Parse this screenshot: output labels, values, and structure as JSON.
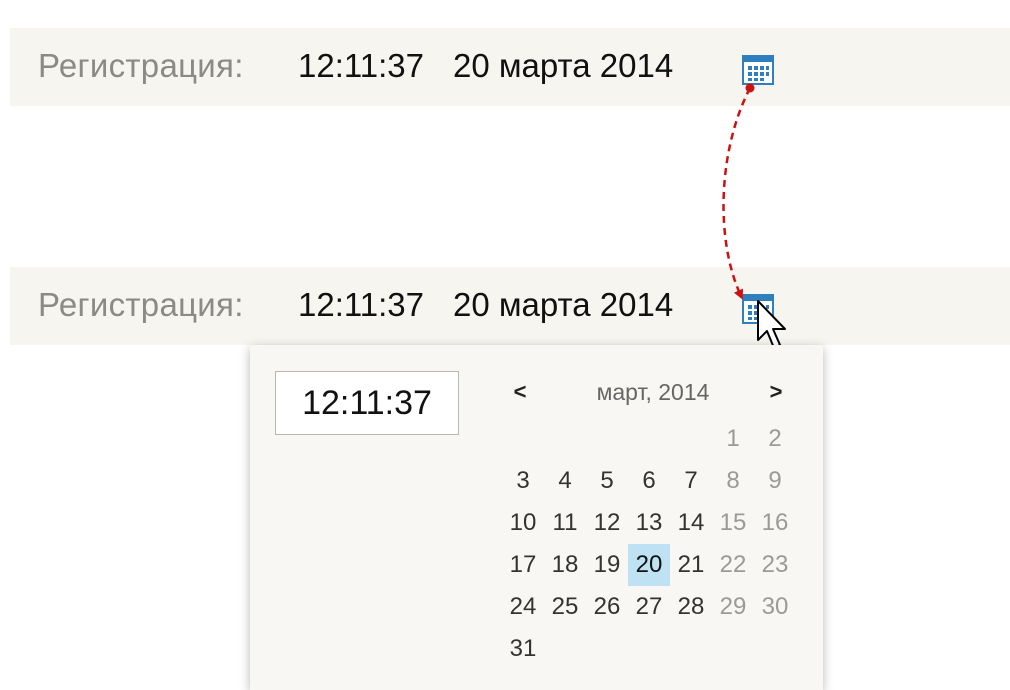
{
  "registration_top": {
    "label": "Регистрация:",
    "time": "12:11:37",
    "date": "20 марта 2014",
    "icon": "calendar-icon"
  },
  "registration_bottom": {
    "label": "Регистрация:",
    "time": "12:11:37",
    "date": "20 марта 2014",
    "icon": "calendar-icon"
  },
  "picker": {
    "time_value": "12:11:37",
    "prev_label": "<",
    "next_label": ">",
    "month_title": "март, 2014",
    "days": [
      {
        "d": "",
        "w": false,
        "s": false
      },
      {
        "d": "",
        "w": false,
        "s": false
      },
      {
        "d": "",
        "w": false,
        "s": false
      },
      {
        "d": "",
        "w": false,
        "s": false
      },
      {
        "d": "",
        "w": false,
        "s": false
      },
      {
        "d": "1",
        "w": true,
        "s": false
      },
      {
        "d": "2",
        "w": true,
        "s": false
      },
      {
        "d": "3",
        "w": false,
        "s": false
      },
      {
        "d": "4",
        "w": false,
        "s": false
      },
      {
        "d": "5",
        "w": false,
        "s": false
      },
      {
        "d": "6",
        "w": false,
        "s": false
      },
      {
        "d": "7",
        "w": false,
        "s": false
      },
      {
        "d": "8",
        "w": true,
        "s": false
      },
      {
        "d": "9",
        "w": true,
        "s": false
      },
      {
        "d": "10",
        "w": false,
        "s": false
      },
      {
        "d": "11",
        "w": false,
        "s": false
      },
      {
        "d": "12",
        "w": false,
        "s": false
      },
      {
        "d": "13",
        "w": false,
        "s": false
      },
      {
        "d": "14",
        "w": false,
        "s": false
      },
      {
        "d": "15",
        "w": true,
        "s": false
      },
      {
        "d": "16",
        "w": true,
        "s": false
      },
      {
        "d": "17",
        "w": false,
        "s": false
      },
      {
        "d": "18",
        "w": false,
        "s": false
      },
      {
        "d": "19",
        "w": false,
        "s": false
      },
      {
        "d": "20",
        "w": false,
        "s": true
      },
      {
        "d": "21",
        "w": false,
        "s": false
      },
      {
        "d": "22",
        "w": true,
        "s": false
      },
      {
        "d": "23",
        "w": true,
        "s": false
      },
      {
        "d": "24",
        "w": false,
        "s": false
      },
      {
        "d": "25",
        "w": false,
        "s": false
      },
      {
        "d": "26",
        "w": false,
        "s": false
      },
      {
        "d": "27",
        "w": false,
        "s": false
      },
      {
        "d": "28",
        "w": false,
        "s": false
      },
      {
        "d": "29",
        "w": true,
        "s": false
      },
      {
        "d": "30",
        "w": true,
        "s": false
      },
      {
        "d": "31",
        "w": false,
        "s": false
      }
    ]
  },
  "colors": {
    "bar_bg": "#f6f5f0",
    "label": "#8a8a86",
    "value": "#111111",
    "weekend": "#9a9a96",
    "selected_bg": "#bfe1f4",
    "icon_blue": "#2f7fbf",
    "annotation_arrow": "#cc1111"
  },
  "annotation": {
    "type": "dashed-curved-arrow",
    "from": "top-calendar-icon",
    "to": "bottom-calendar-icon"
  },
  "cursor": "arrow-pointer"
}
